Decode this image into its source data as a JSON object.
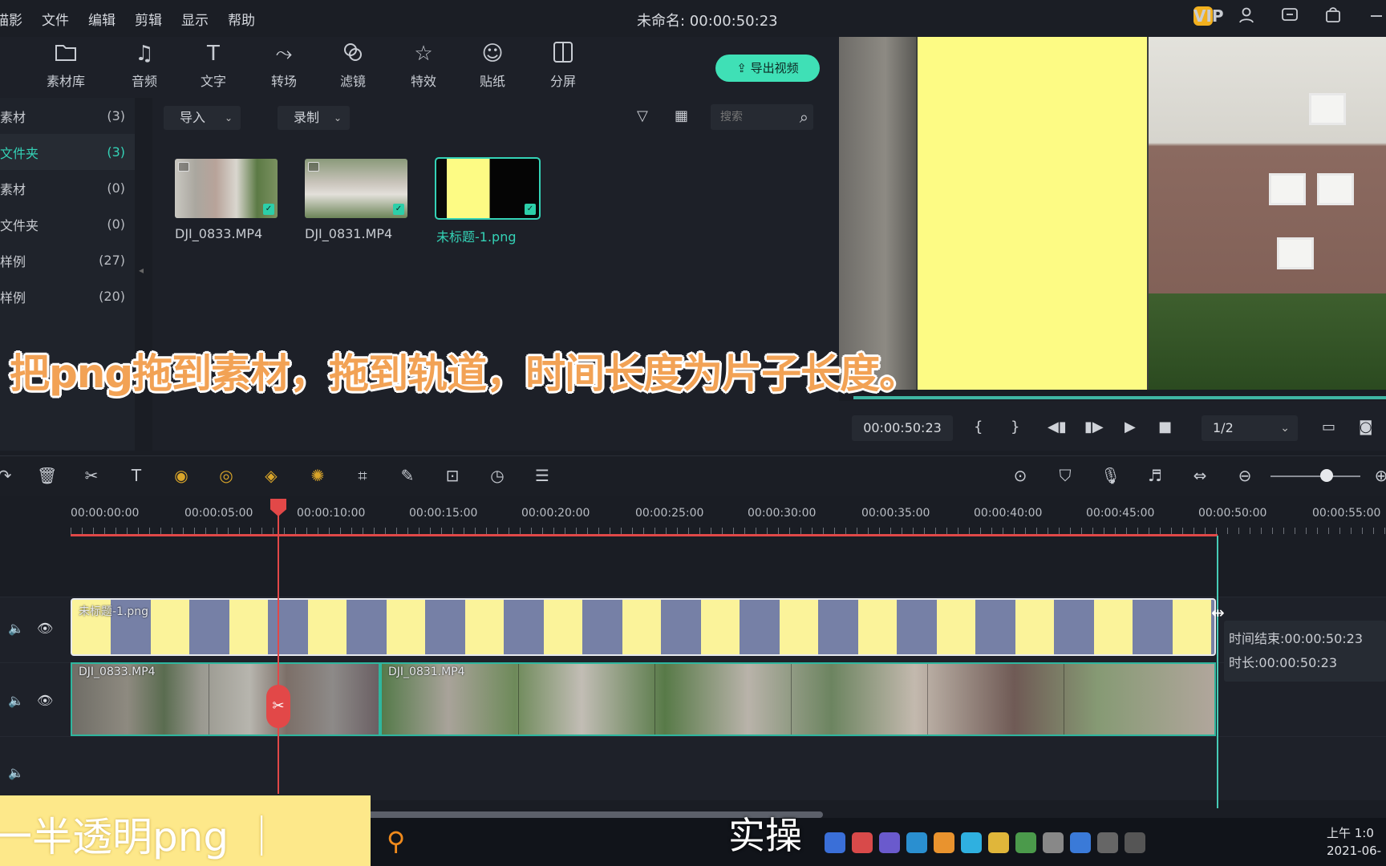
{
  "menubar": {
    "app_fragment": "喵影",
    "items": [
      "文件",
      "编辑",
      "剪辑",
      "显示",
      "帮助"
    ],
    "doc_title": "未命名: 00:00:50:23",
    "vip_badge": "VIP"
  },
  "tabs": [
    {
      "label": "素材库",
      "icon": "folder-icon"
    },
    {
      "label": "音频",
      "icon": "music-note-icon"
    },
    {
      "label": "文字",
      "icon": "text-icon"
    },
    {
      "label": "转场",
      "icon": "transition-icon"
    },
    {
      "label": "滤镜",
      "icon": "filter-icon"
    },
    {
      "label": "特效",
      "icon": "effects-icon"
    },
    {
      "label": "贴纸",
      "icon": "sticker-icon"
    },
    {
      "label": "分屏",
      "icon": "split-screen-icon"
    }
  ],
  "export_button": "导出视频",
  "library": {
    "items": [
      {
        "label": "素材",
        "count": "(3)"
      },
      {
        "label": "文件夹",
        "count": "(3)"
      },
      {
        "label": "素材",
        "count": "(0)"
      },
      {
        "label": "文件夹",
        "count": "(0)"
      },
      {
        "label": "样例",
        "count": "(27)"
      },
      {
        "label": "样例",
        "count": "(20)"
      }
    ],
    "selected_index": 1
  },
  "media_bar": {
    "import_label": "导入",
    "record_label": "录制",
    "search_placeholder": "搜索"
  },
  "media_items": [
    {
      "name": "DJI_0833.MP4",
      "selected": false
    },
    {
      "name": "DJI_0831.MP4",
      "selected": false
    },
    {
      "name": "未标题-1.png",
      "selected": true
    }
  ],
  "preview": {
    "timecode": "00:00:50:23",
    "ratio": "1/2"
  },
  "subtitle_caption": "把png拖到素材，拖到轨道，时间长度为片子长度。",
  "ruler": {
    "labels": [
      "00:00:00:00",
      "00:00:05:00",
      "00:00:10:00",
      "00:00:15:00",
      "00:00:20:00",
      "00:00:25:00",
      "00:00:30:00",
      "00:00:35:00",
      "00:00:40:00",
      "00:00:45:00",
      "00:00:50:00",
      "00:00:55:00"
    ]
  },
  "tracks": {
    "png_clip_label": "未标题-1.png",
    "video_clip_1": "DJI_0833.MP4",
    "video_clip_2": "DJI_0831.MP4"
  },
  "tooltip": {
    "end_time": "时间结束:00:00:50:23",
    "duration": "时长:00:00:50:23"
  },
  "banner_text": "一半透明png",
  "banner_right": "实操",
  "clock": {
    "time": "上午 1:0",
    "date": "2021-06-"
  },
  "colors": {
    "accent": "#34d2b6",
    "export_button": "#3fe0b6",
    "playhead": "#e24848",
    "png_yellow": "#fdfb84",
    "subtitle_orange": "#f2a255"
  }
}
